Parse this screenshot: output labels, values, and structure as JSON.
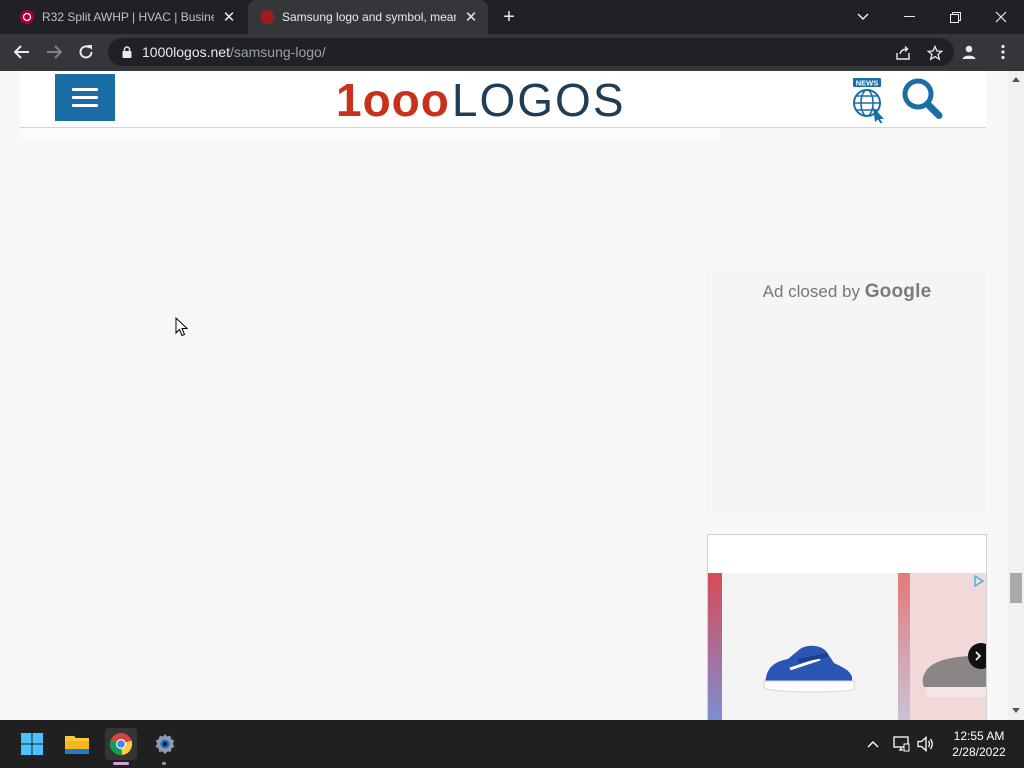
{
  "browser": {
    "tabs": [
      {
        "title": "R32 Split AWHP | HVAC | Busines",
        "active": false,
        "favicon_color": "#a50034"
      },
      {
        "title": "Samsung logo and symbol, mean",
        "active": true,
        "favicon_color": "#c8321b"
      }
    ],
    "new_tab_symbol": "+",
    "url_domain": "1000logos.net",
    "url_path": "/samsung-logo/"
  },
  "page": {
    "logo_number": "1ooo",
    "logo_word": "LOGOS",
    "news_label": "NEWS",
    "ad_closed_prefix": "Ad closed by",
    "ad_closed_brand": "Google",
    "brand_colors": {
      "accent": "#1b6ea5",
      "logo_red": "#c8321b",
      "logo_dark": "#1f3d57"
    }
  },
  "taskbar": {
    "time": "12:55 AM",
    "date": "2/28/2022",
    "apps": [
      "windows-start",
      "file-explorer",
      "chrome",
      "settings"
    ]
  }
}
